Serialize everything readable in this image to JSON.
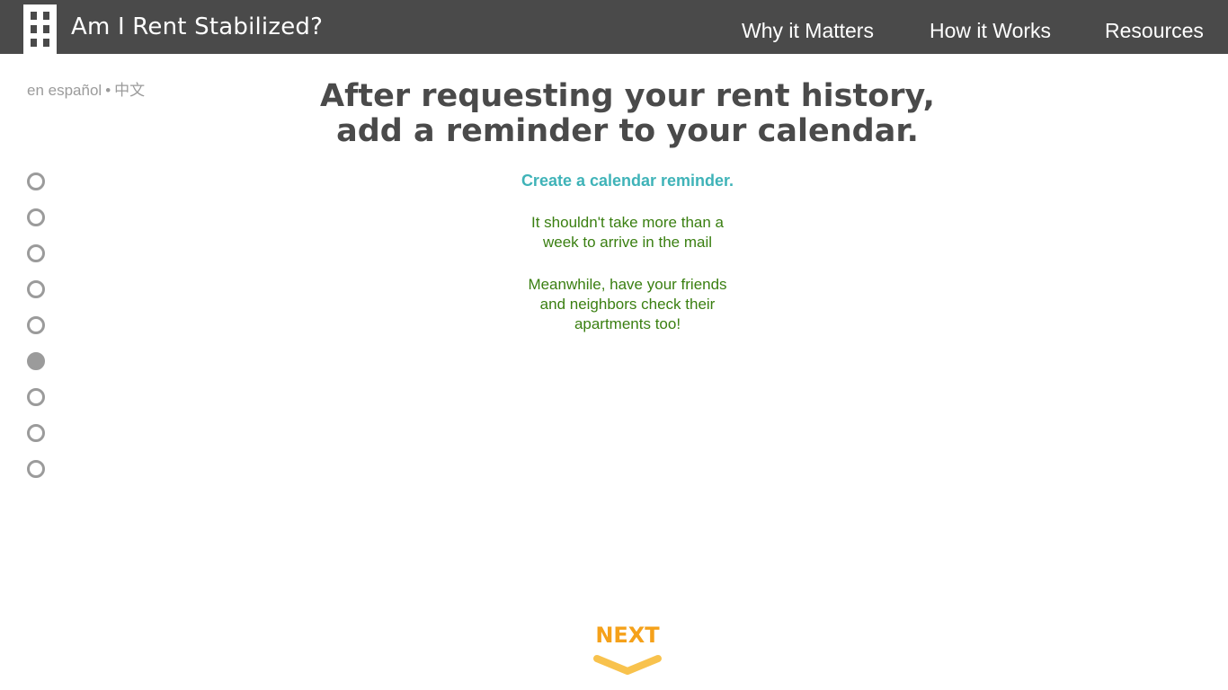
{
  "header": {
    "brand": "Am I Rent Stabilized?",
    "logo_icon": "building-icon",
    "nav": [
      {
        "label": "Why it Matters"
      },
      {
        "label": "How it Works"
      },
      {
        "label": "Resources"
      }
    ],
    "background_color": "#4a4a4a"
  },
  "language": {
    "spanish": "en español",
    "separator": "•",
    "chinese": "中文"
  },
  "progress": {
    "total_steps": 9,
    "current_step": 6
  },
  "main": {
    "heading_line1": "After requesting your rent history,",
    "heading_line2": "add a reminder to your calendar.",
    "calendar_link": "Create a calendar reminder.",
    "para1_line1": "It shouldn't take more than a",
    "para1_line2": "week to arrive in the mail",
    "para2_line1": "Meanwhile, have your friends",
    "para2_line2": "and neighbors check their",
    "para2_line3": "apartments too!"
  },
  "next": {
    "label": "NEXT",
    "icon": "chevron-down-icon",
    "color": "#f5a11a"
  },
  "colors": {
    "link_teal": "#3fb3b8",
    "text_green": "#3a7f11",
    "muted_gray": "#9b9b9b"
  }
}
